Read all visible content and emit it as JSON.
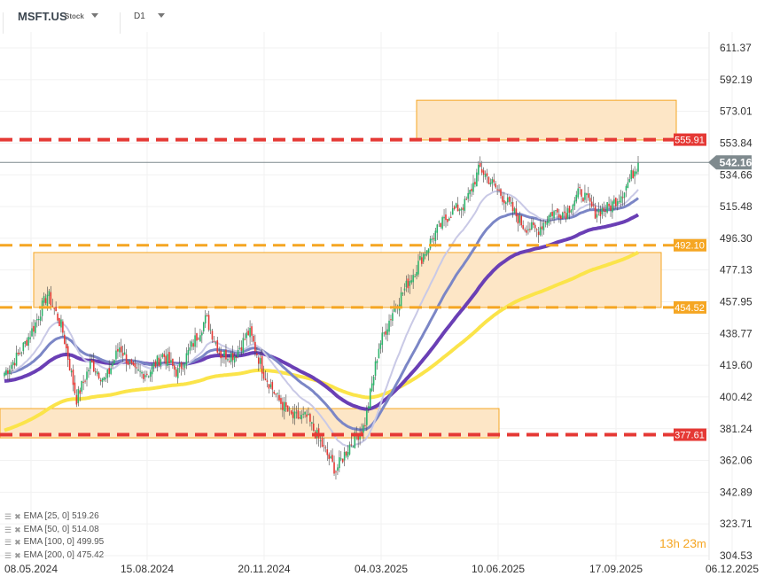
{
  "header": {
    "symbol": "MSFT.US",
    "type": "Stock",
    "timeframe": "D1"
  },
  "timer": {
    "hours": "13",
    "h": "h",
    "minutes": "23",
    "m": "m"
  },
  "legend": [
    {
      "label": "EMA [25,  0] 519.26",
      "color": "#c9c9e6"
    },
    {
      "label": "EMA [50,  0] 514.08",
      "color": "#7b86c6"
    },
    {
      "label": "EMA [100,  0] 499.95",
      "color": "#6a3fb5"
    },
    {
      "label": "EMA [200,  0] 475.42",
      "color": "#fbe44a"
    }
  ],
  "chart_data": {
    "type": "candlestick",
    "x_tick_labels": [
      "08.05.2024",
      "15.08.2024",
      "20.11.2024",
      "04.03.2025",
      "10.06.2025",
      "17.09.2025",
      "06.12.2025"
    ],
    "y_tick_labels": [
      "611.37",
      "592.19",
      "573.01",
      "553.84",
      "534.66",
      "515.48",
      "496.30",
      "477.13",
      "457.95",
      "438.77",
      "419.60",
      "400.42",
      "381.24",
      "362.06",
      "342.89",
      "323.71",
      "304.53"
    ],
    "ylim": [
      304.53,
      611.37
    ],
    "approx_closes": [
      415,
      426,
      442,
      463,
      442,
      399,
      421,
      410,
      431,
      415,
      415,
      426,
      415,
      431,
      448,
      426,
      426,
      440,
      415,
      399,
      388,
      388,
      372,
      356,
      372,
      383,
      431,
      453,
      469,
      485,
      501,
      512,
      517,
      539,
      528,
      517,
      504,
      501,
      512,
      512,
      525,
      512,
      515,
      525,
      542
    ],
    "current_price": "542.16",
    "levels": [
      {
        "label": "555.91",
        "value": 555.91,
        "color": "#e53935",
        "style": "dashed"
      },
      {
        "label": "492.10",
        "value": 492.1,
        "color": "#f5a623",
        "style": "dashed"
      },
      {
        "label": "454.52",
        "value": 454.52,
        "color": "#f5a623",
        "style": "dashed"
      },
      {
        "label": "377.61",
        "value": 377.61,
        "color": "#e53935",
        "style": "dashed"
      }
    ],
    "zones": [
      {
        "from": 555.7,
        "to": 579.7
      },
      {
        "from": 454.5,
        "to": 487.7
      },
      {
        "from": 375.7,
        "to": 393.4
      }
    ],
    "ema_periods": [
      25,
      50,
      100,
      200
    ],
    "colors": {
      "up": "#2db36b",
      "down": "#e53935",
      "zone_fill": "#fde6c6",
      "zone_border": "#f5a623",
      "price_tag": "#7f8a8e"
    }
  }
}
